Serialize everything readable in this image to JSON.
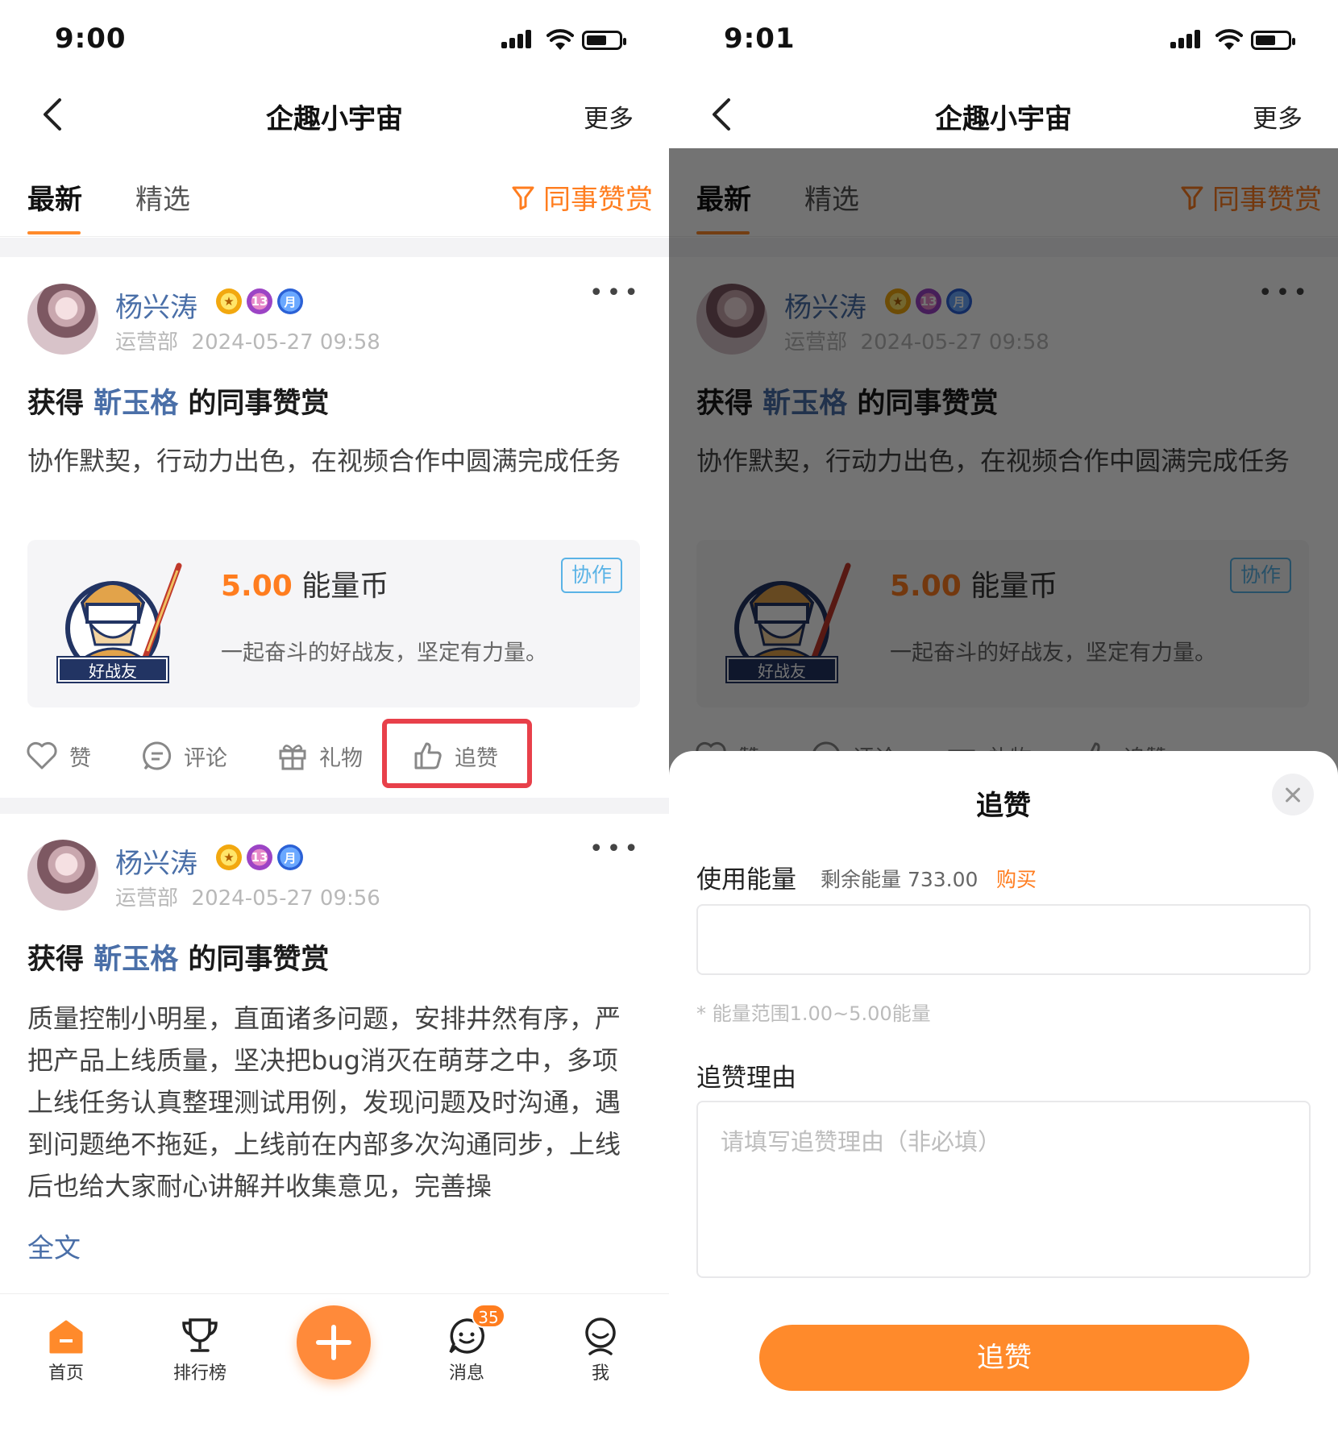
{
  "left": {
    "status": {
      "time": "9:00"
    },
    "nav": {
      "title": "企趣小宇宙",
      "more": "更多"
    },
    "tabs": [
      {
        "label": "最新",
        "active": true
      },
      {
        "label": "精选",
        "active": false
      }
    ],
    "filter": "同事赞赏",
    "posts": [
      {
        "name": "杨兴涛",
        "badges": [
          "star",
          "13",
          "月"
        ],
        "dept": "运营部",
        "time": "2024-05-27 09:58",
        "title_pre": "获得 ",
        "title_who": "靳玉格",
        "title_post": " 的同事赞赏",
        "body": "协作默契，行动力出色，在视频合作中圆满完成任务",
        "card": {
          "amount": "5.00",
          "unit": "能量币",
          "tag": "协作",
          "quote": "一起奋斗的好战友，坚定有力量。",
          "medal": "好战友"
        },
        "actions": {
          "like": "赞",
          "comment": "评论",
          "gift": "礼物",
          "praise": "追赞"
        }
      },
      {
        "name": "杨兴涛",
        "badges": [
          "star",
          "13",
          "月"
        ],
        "dept": "运营部",
        "time": "2024-05-27 09:56",
        "title_pre": "获得 ",
        "title_who": "靳玉格",
        "title_post": " 的同事赞赏",
        "body": "质量控制小明星，直面诸多问题，安排井然有序，严把产品上线质量，坚决把bug消灭在萌芽之中，多项上线任务认真整理测试用例，发现问题及时沟通，遇到问题绝不拖延，上线前在内部多次沟通同步，上线后也给大家耐心讲解并收集意见，完善操",
        "fulltext": "全文"
      }
    ],
    "tabbar": {
      "home": "首页",
      "rank": "排行榜",
      "msg": "消息",
      "msg_badge": "35",
      "me": "我"
    }
  },
  "right": {
    "status": {
      "time": "9:01"
    },
    "sheet": {
      "title": "追赞",
      "energy_label": "使用能量",
      "remain": "剩余能量 733.00",
      "buy": "购买",
      "range_hint": "* 能量范围1.00~5.00能量",
      "reason_label": "追赞理由",
      "reason_placeholder": "请填写追赞理由（非必填）",
      "submit": "追赞"
    }
  },
  "colors": {
    "accent": "#ff8a2b",
    "link": "#4a6fa8",
    "highlight": "#e8404a"
  }
}
